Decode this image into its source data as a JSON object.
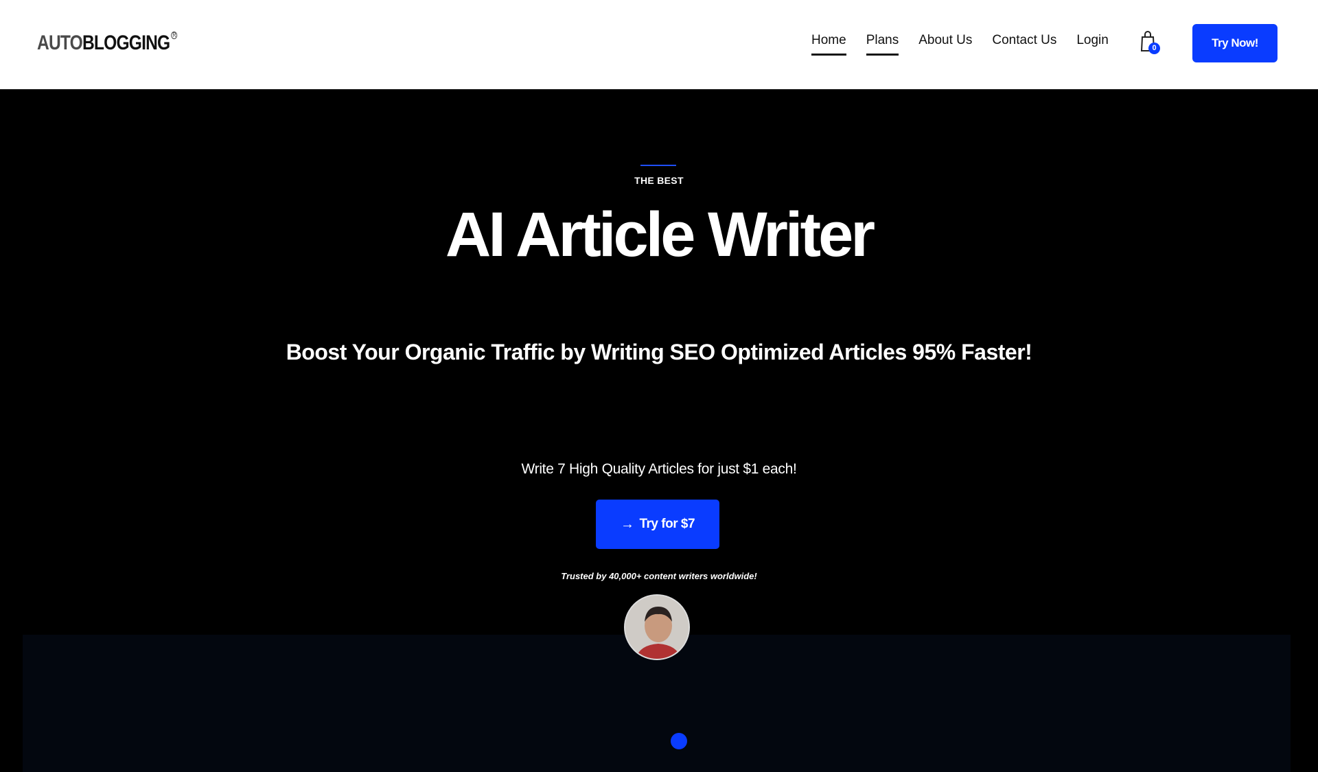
{
  "header": {
    "logo": {
      "part1": "AUTO",
      "part2": "BLOGGING",
      "mark": "R"
    },
    "nav": [
      {
        "label": "Home",
        "underlined": true
      },
      {
        "label": "Plans",
        "underlined": true
      },
      {
        "label": "About Us",
        "underlined": false
      },
      {
        "label": "Contact Us",
        "underlined": false
      },
      {
        "label": "Login",
        "underlined": false
      }
    ],
    "cart": {
      "icon": "shopping-bag-icon",
      "count": "0"
    },
    "try_now_label": "Try Now!"
  },
  "hero": {
    "eyebrow": "THE BEST",
    "headline": "AI Article Writer",
    "subheadline": "Boost Your Organic Traffic by Writing SEO Optimized Articles 95% Faster!",
    "offer": "Write 7 High Quality Articles for just $1 each!",
    "cta_icon": "arrow-right-icon",
    "cta_label": "Try for $7",
    "trusted": "Trusted by 40,000+ content writers worldwide!"
  },
  "colors": {
    "accent": "#0a3cff",
    "hero_bg": "#000000",
    "panel_bg": "#03070f",
    "header_bg": "#ffffff"
  }
}
